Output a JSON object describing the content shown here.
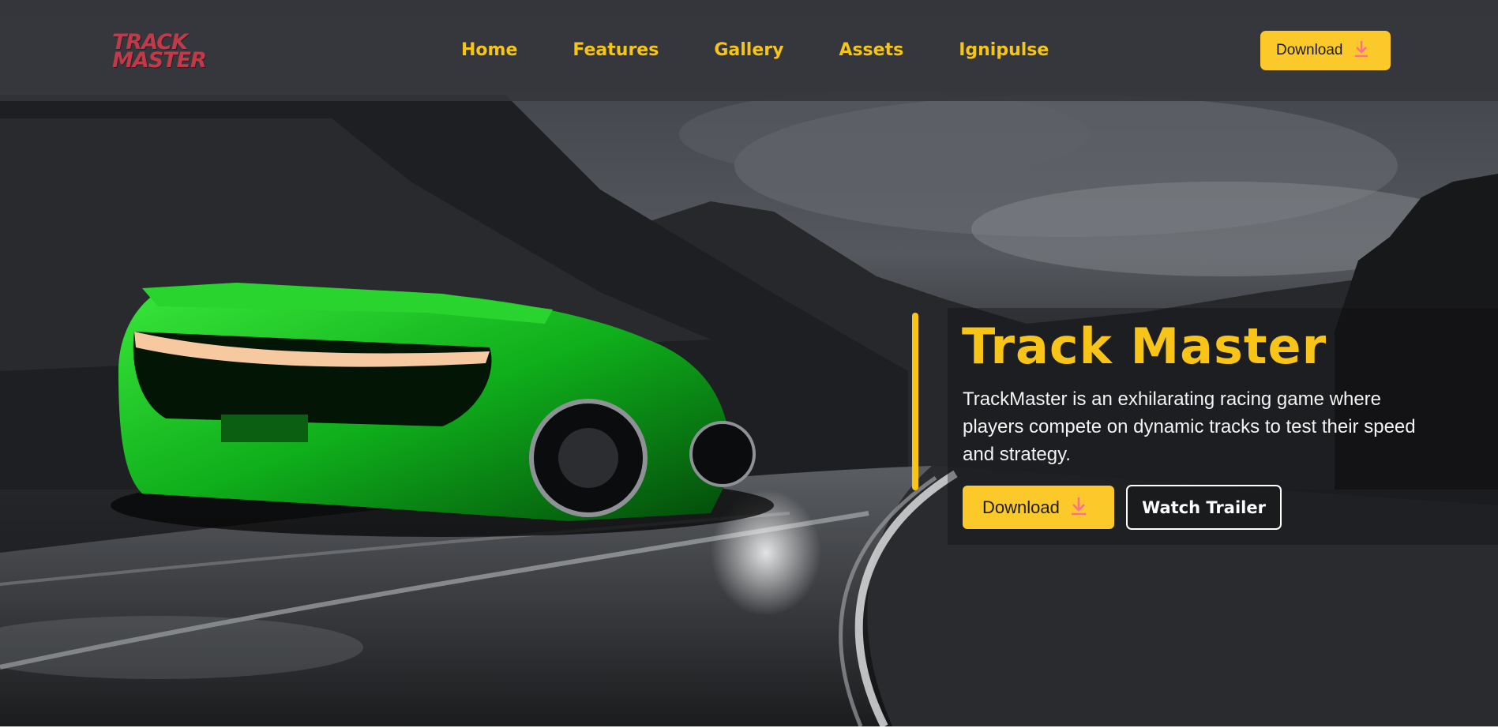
{
  "brand": {
    "logo_line1": "TRACK",
    "logo_line2": "MASTER",
    "logo_color": "#c23a4a"
  },
  "nav": {
    "links": [
      "Home",
      "Features",
      "Gallery",
      "Assets",
      "Ignipulse"
    ],
    "download_label": "Download",
    "download_icon": "download-arrow-icon"
  },
  "hero": {
    "title": "Track Master",
    "description": "TrackMaster is an exhilarating racing game where players compete on dynamic tracks to test their speed and strategy.",
    "primary_button": "Download",
    "secondary_button": "Watch Trailer",
    "background": "green sports car on a wet mountain road under a stormy sky"
  },
  "colors": {
    "accent": "#f7c417",
    "button": "#fbc92a",
    "navbar_bg": "#34363b",
    "icon_pink": "#ff6f91"
  }
}
